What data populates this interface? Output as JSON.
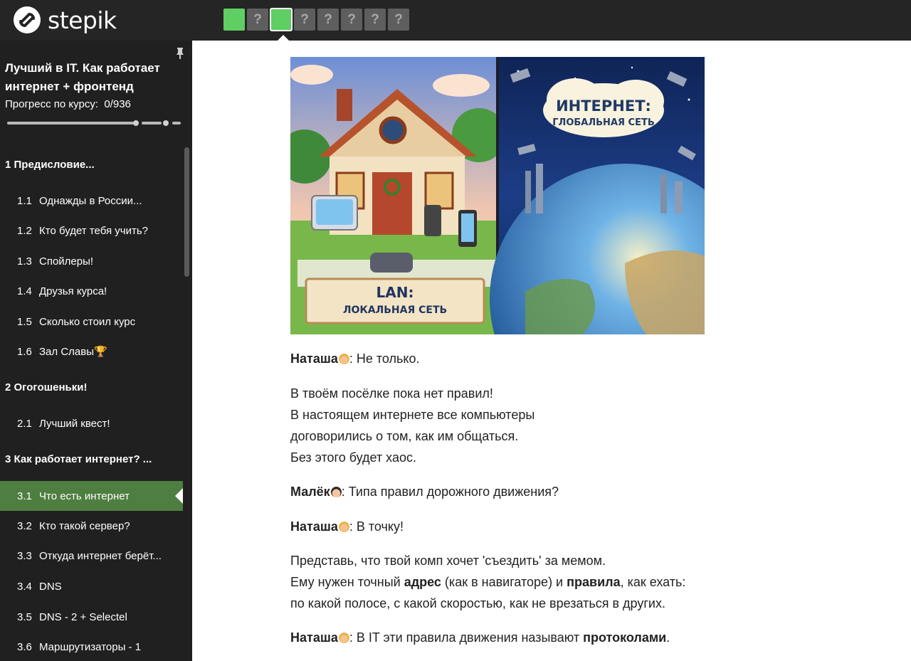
{
  "app": {
    "logo_text": "stepik"
  },
  "steps": [
    {
      "label": "",
      "state": "done"
    },
    {
      "label": "?",
      "state": "todo"
    },
    {
      "label": "",
      "state": "current"
    },
    {
      "label": "?",
      "state": "todo"
    },
    {
      "label": "?",
      "state": "todo"
    },
    {
      "label": "?",
      "state": "todo"
    },
    {
      "label": "?",
      "state": "todo"
    },
    {
      "label": "?",
      "state": "todo"
    }
  ],
  "sidebar": {
    "course_title": "Лучший в IT. Как работает интернет + фронтенд",
    "progress_label": "Прогресс по курсу:",
    "progress_value": "0/936",
    "sections": [
      {
        "title": "1  Предисловие..."
      },
      {
        "title": "2  Огогошеньки!"
      },
      {
        "title": "3  Как работает интернет? ..."
      }
    ],
    "lessons": [
      {
        "num": "1.1",
        "title": "Однажды в России..."
      },
      {
        "num": "1.2",
        "title": "Кто будет тебя учить?"
      },
      {
        "num": "1.3",
        "title": "Спойлеры!"
      },
      {
        "num": "1.4",
        "title": "Друзья курса!"
      },
      {
        "num": "1.5",
        "title": "Сколько стоил курс"
      },
      {
        "num": "1.6",
        "title": "Зал Славы🏆"
      },
      {
        "num": "2.1",
        "title": "Лучший квест!"
      },
      {
        "num": "3.1",
        "title": "Что есть интернет"
      },
      {
        "num": "3.2",
        "title": "Кто такой сервер?"
      },
      {
        "num": "3.3",
        "title": "Откуда интернет берёт..."
      },
      {
        "num": "3.4",
        "title": "DNS"
      },
      {
        "num": "3.5",
        "title": "DNS - 2 + Selectel"
      },
      {
        "num": "3.6",
        "title": "Маршрутизаторы - 1"
      }
    ]
  },
  "hero": {
    "left_banner_title": "LAN:",
    "left_banner_subtitle": "ЛОКАЛЬНАЯ СЕТЬ",
    "right_cloud_title": "ИНТЕРНЕТ:",
    "right_cloud_subtitle": "ГЛОБАЛЬНАЯ СЕТЬ"
  },
  "content": {
    "p1_speaker": "Наташа",
    "p1_text": ": Не только.",
    "p2_line1": "В твоём посёлке пока нет правил!",
    "p2_line2": "В настоящем интернете все компьютеры",
    "p2_line3": "договорились о том, как им общаться.",
    "p2_line4": "Без этого будет хаос.",
    "p3_speaker": "Малёк",
    "p3_text": ": Типа правил дорожного движения?",
    "p4_speaker": "Наташа",
    "p4_text": ": В точку!",
    "p5_line1": "Представь, что твой комп хочет 'съездить' за мемом.",
    "p5_line2_a": "Ему нужен точный ",
    "p5_line2_b": "адрес",
    "p5_line2_c": " (как в навигаторе) и ",
    "p5_line2_d": "правила",
    "p5_line2_e": ", как ехать:",
    "p5_line3": "по какой полосе, с какой скоростью, как не врезаться в других.",
    "p6_speaker": "Наташа",
    "p6_text_a": ": В IT эти правила движения называют ",
    "p6_text_b": "протоколами",
    "p6_text_c": "."
  }
}
